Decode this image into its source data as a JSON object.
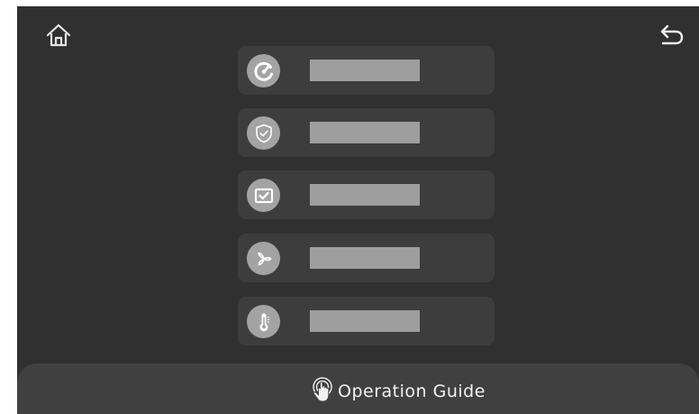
{
  "icons": {
    "home": "home-icon",
    "back": "back-arrow-icon",
    "guide": "touch-hand-icon"
  },
  "menu": {
    "items": [
      {
        "icon": "speedometer-icon",
        "label": ""
      },
      {
        "icon": "shield-check-icon",
        "label": ""
      },
      {
        "icon": "checkbox-icon",
        "label": ""
      },
      {
        "icon": "fan-icon",
        "label": ""
      },
      {
        "icon": "thermometer-icon",
        "label": ""
      }
    ]
  },
  "footer": {
    "guide_label": "Operation Guide"
  },
  "colors": {
    "background": "#303030",
    "card": "#3d3d3d",
    "icon_circle": "#a3a3a3",
    "label_placeholder": "#9e9e9e",
    "footer": "#404040",
    "text": "#f2f2f2"
  }
}
